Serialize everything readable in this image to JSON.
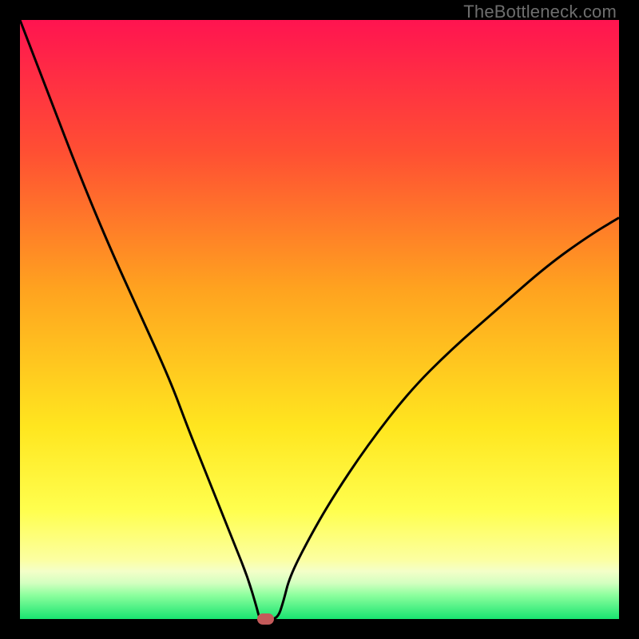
{
  "watermark": {
    "text": "TheBottleneck.com"
  },
  "gradient": {
    "stops": [
      {
        "pct": 0,
        "color": "#ff1450"
      },
      {
        "pct": 22,
        "color": "#ff4f33"
      },
      {
        "pct": 45,
        "color": "#ffa31f"
      },
      {
        "pct": 68,
        "color": "#ffe61f"
      },
      {
        "pct": 82,
        "color": "#ffff4f"
      },
      {
        "pct": 90,
        "color": "#fcffa0"
      },
      {
        "pct": 92,
        "color": "#f4ffc8"
      },
      {
        "pct": 94,
        "color": "#d3ffc0"
      },
      {
        "pct": 96,
        "color": "#8dff9e"
      },
      {
        "pct": 100,
        "color": "#18e470"
      }
    ]
  },
  "chart_data": {
    "type": "line",
    "title": "",
    "xlabel": "",
    "ylabel": "",
    "xlim": [
      0,
      100
    ],
    "ylim": [
      0,
      100
    ],
    "x": [
      0,
      5,
      10,
      15,
      20,
      25,
      28,
      30,
      32,
      34,
      36,
      38,
      39.5,
      40,
      41,
      43,
      44,
      45,
      48,
      52,
      58,
      65,
      72,
      80,
      88,
      95,
      100
    ],
    "values": [
      100,
      87,
      74,
      62,
      51,
      40,
      32,
      27,
      22,
      17,
      12,
      7,
      2,
      0,
      0,
      0,
      3,
      7,
      13,
      20,
      29,
      38,
      45,
      52,
      59,
      64,
      67
    ],
    "flat_range_x": [
      39.5,
      43
    ],
    "marker": {
      "x": 41,
      "y": 0,
      "color": "#c45a5a",
      "width_frac": 0.028,
      "height_frac": 0.018
    },
    "curve_style": {
      "stroke": "#000000",
      "stroke_width": 3
    }
  }
}
